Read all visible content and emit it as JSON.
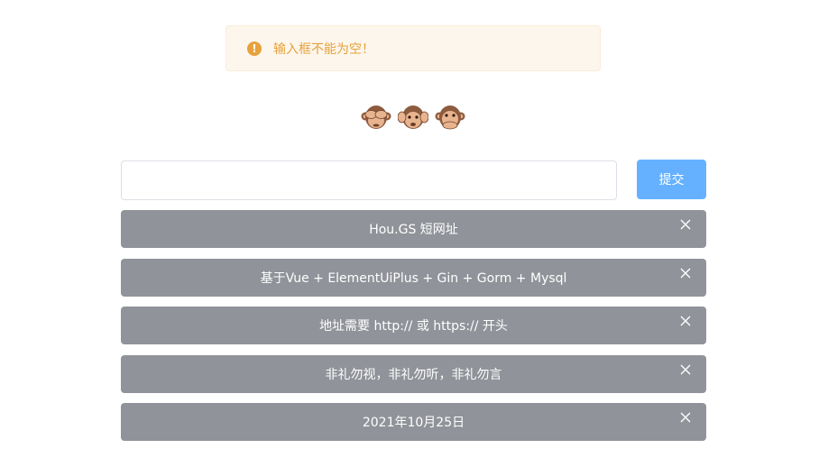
{
  "alert": {
    "icon": "warning-icon",
    "color": "#e6a23c",
    "message": "输入框不能为空！"
  },
  "header": {
    "icons": [
      "see-no-evil-monkey-icon",
      "hear-no-evil-monkey-icon",
      "speak-no-evil-monkey-icon"
    ]
  },
  "form": {
    "input_value": "",
    "submit_label": "提交",
    "button_color": "#66b1ff"
  },
  "cards": {
    "background": "#909399",
    "items": [
      {
        "text": "Hou.GS 短网址"
      },
      {
        "text": "基于Vue + ElementUiPlus + Gin + Gorm + Mysql"
      },
      {
        "text": "地址需要 http:// 或 https:// 开头"
      },
      {
        "text": "非礼勿视，非礼勿听，非礼勿言"
      },
      {
        "text": "2021年10月25日"
      }
    ]
  }
}
